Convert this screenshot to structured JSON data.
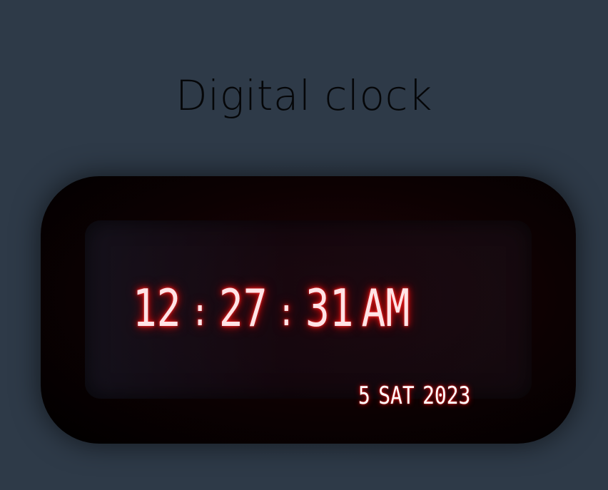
{
  "header": {
    "title": "Digital clock"
  },
  "clock": {
    "hours": "12",
    "minutes": "27",
    "seconds": "31",
    "separator": ":",
    "period": "AM",
    "date": {
      "day": "5",
      "weekday": "SAT",
      "year": "2023"
    }
  },
  "colors": {
    "background": "#2e3a48",
    "title": "#050608",
    "frame": "#000000",
    "digit_glow": "#e01010",
    "digit": "#ffe4e6",
    "date": "#ffffff"
  }
}
